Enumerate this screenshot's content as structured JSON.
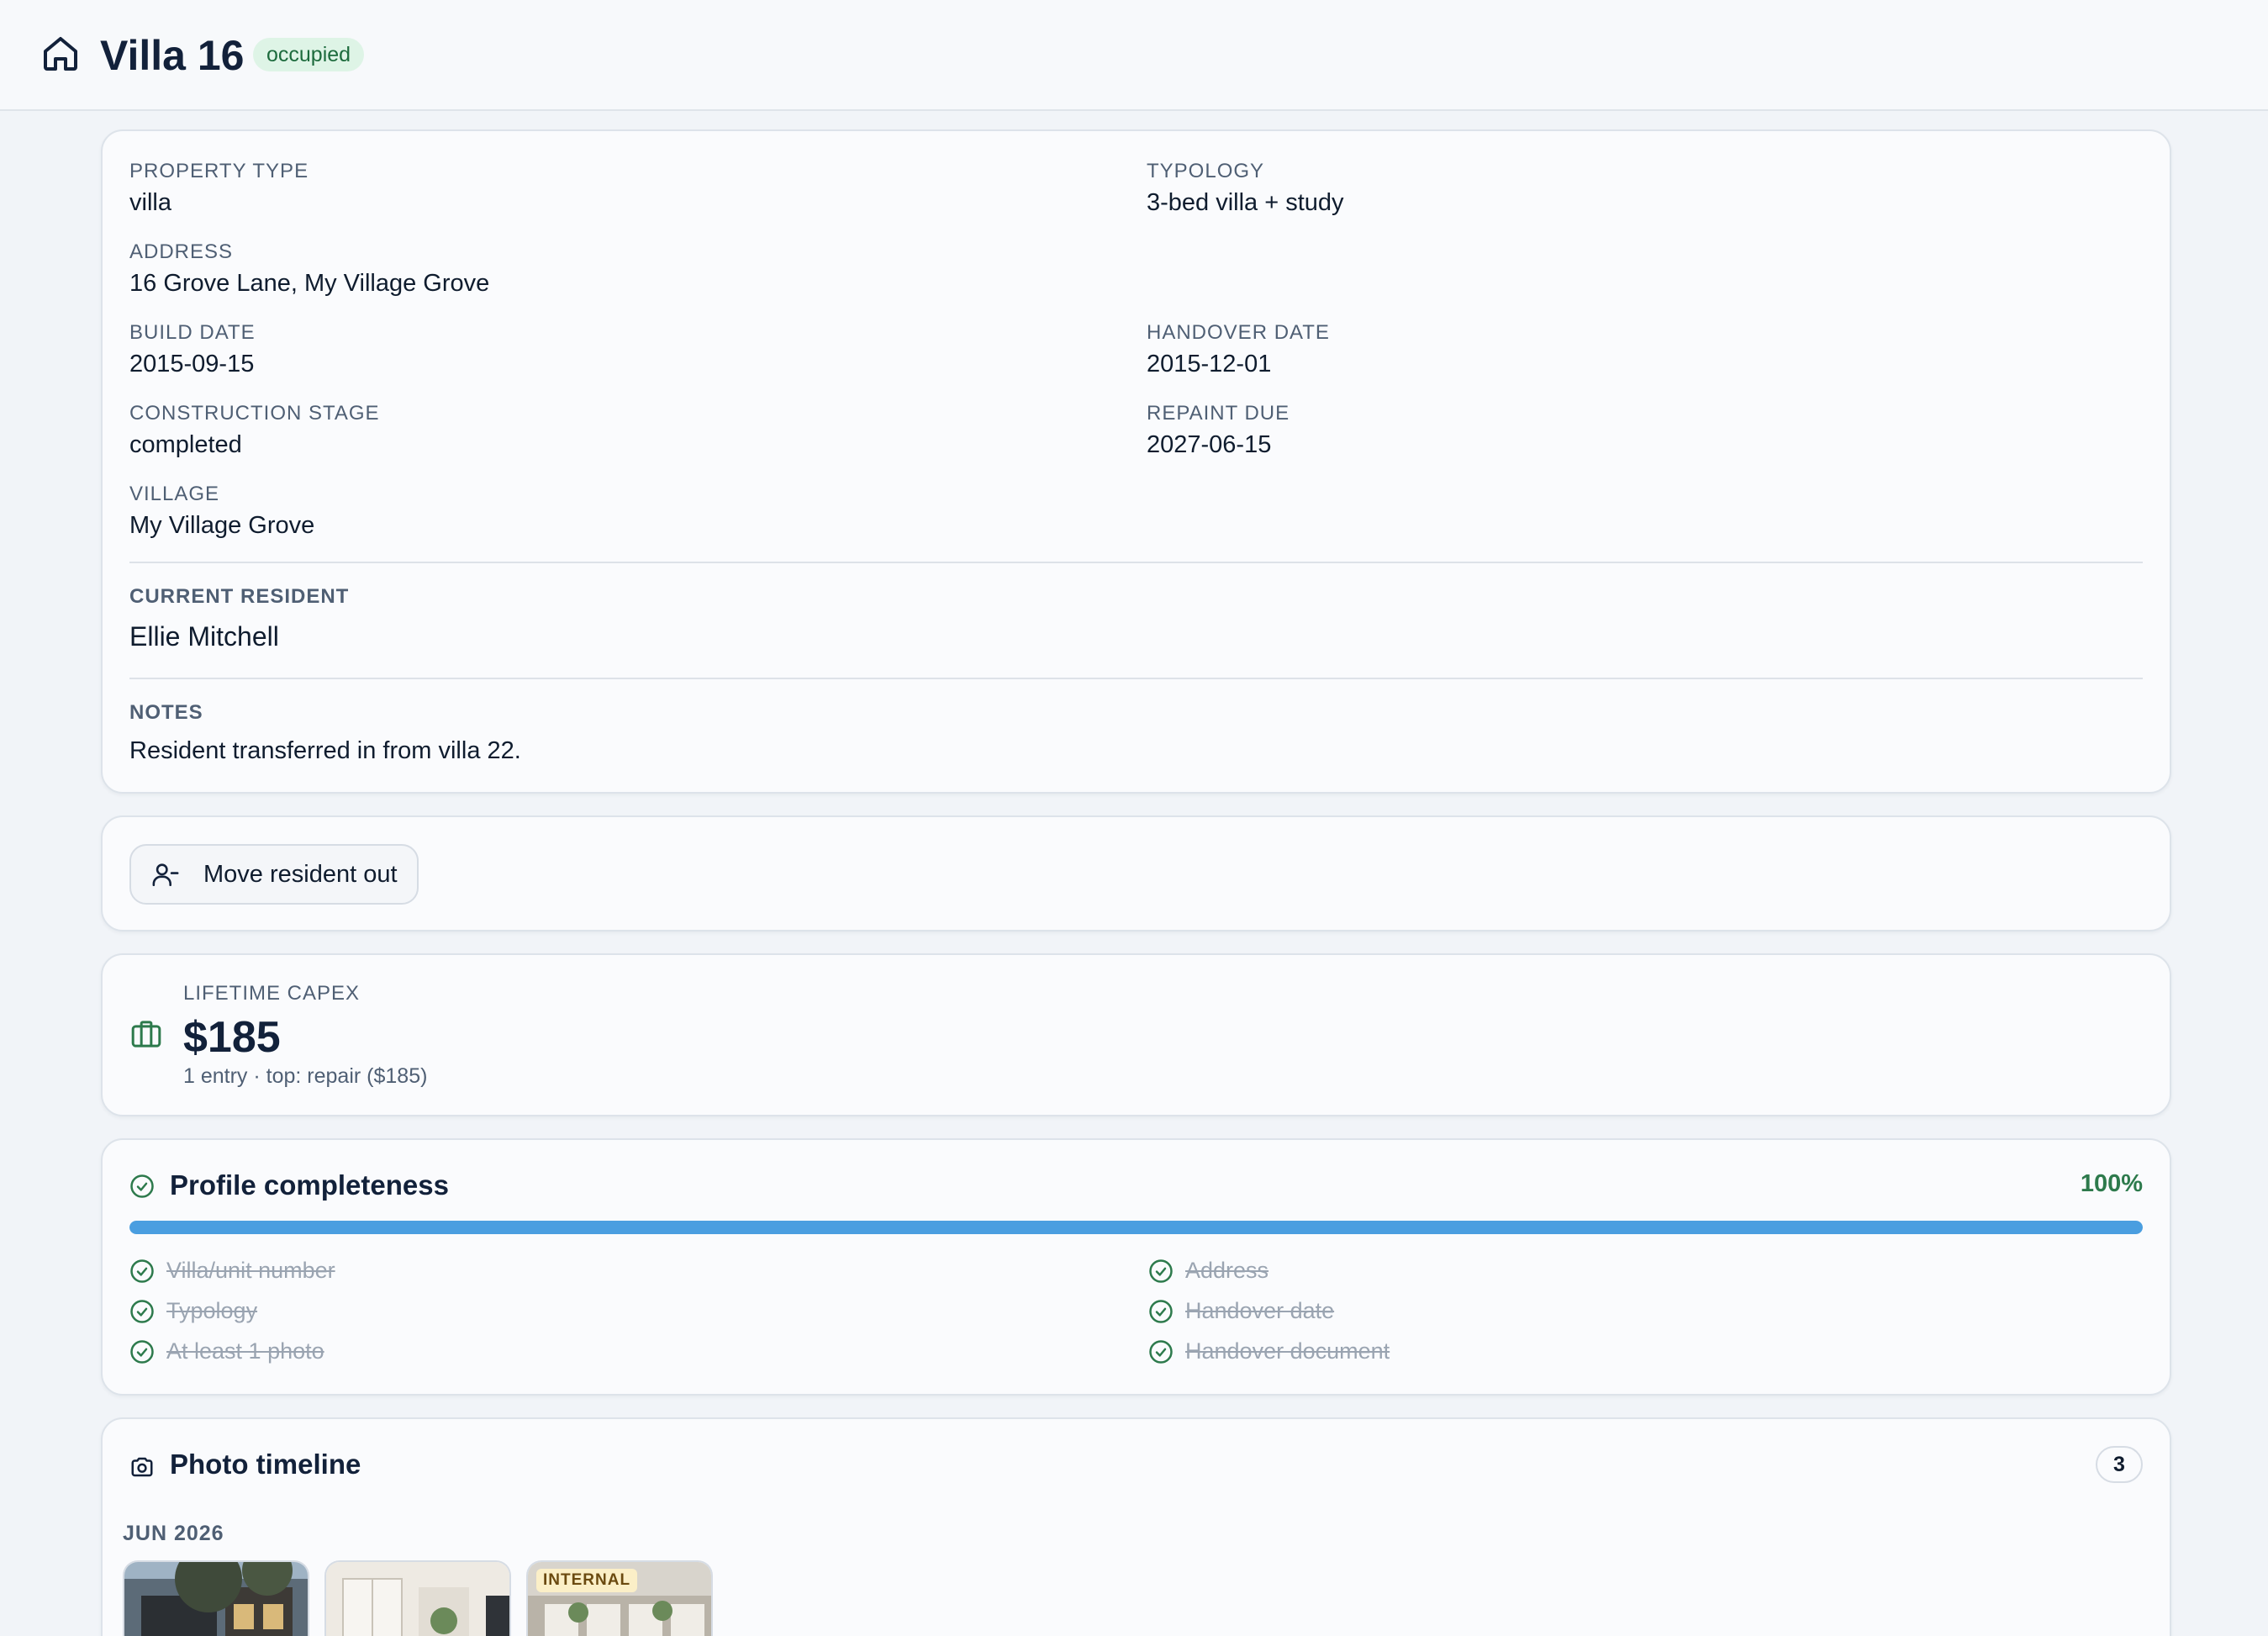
{
  "header": {
    "title": "Villa 16",
    "status_badge": "occupied",
    "icon": "home-icon"
  },
  "details": {
    "fields": [
      {
        "label": "PROPERTY TYPE",
        "value": "villa"
      },
      {
        "label": "TYPOLOGY",
        "value": "3-bed villa + study"
      },
      {
        "label": "ADDRESS",
        "value": "16 Grove Lane, My Village Grove"
      },
      {
        "label": "BUILD DATE",
        "value": "2015-09-15"
      },
      {
        "label": "HANDOVER DATE",
        "value": "2015-12-01"
      },
      {
        "label": "CONSTRUCTION STAGE",
        "value": "completed"
      },
      {
        "label": "REPAINT DUE",
        "value": "2027-06-15"
      },
      {
        "label": "VILLAGE",
        "value": "My Village Grove"
      }
    ],
    "current_resident_label": "CURRENT RESIDENT",
    "current_resident": "Ellie Mitchell",
    "notes_label": "NOTES",
    "notes": "Resident transferred in from villa 22."
  },
  "actions": {
    "move_out_label": "Move resident out",
    "move_out_icon": "user-minus-icon"
  },
  "capex": {
    "label": "LIFETIME CAPEX",
    "value": "$185",
    "summary": "1 entry · top: repair ($185)",
    "icon": "briefcase-icon",
    "icon_color": "#2d7a4c"
  },
  "profile_completeness": {
    "title": "Profile completeness",
    "percent_label": "100%",
    "percent": 100,
    "bar_color": "#4a9ee0",
    "check_color": "#2d7a4c",
    "items": [
      {
        "label": "Villa/unit number",
        "done": true
      },
      {
        "label": "Address",
        "done": true
      },
      {
        "label": "Typology",
        "done": true
      },
      {
        "label": "Handover date",
        "done": true
      },
      {
        "label": "At least 1 photo",
        "done": true
      },
      {
        "label": "Handover document",
        "done": true
      }
    ]
  },
  "photo_timeline": {
    "title": "Photo timeline",
    "count": "3",
    "month": "JUN 2026",
    "photos": [
      {
        "name": "exterior"
      },
      {
        "name": "interior-living"
      },
      {
        "name": "interior",
        "tag": "INTERNAL"
      }
    ]
  }
}
